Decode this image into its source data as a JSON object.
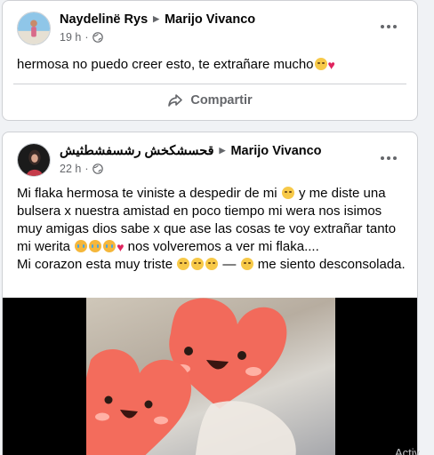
{
  "post1": {
    "author": "Naydelinë Rys",
    "target": "Marijo Vivanco",
    "time": "19 h",
    "text": "hermosa no puedo creer esto, te extrañare mucho",
    "share_label": "Compartir"
  },
  "post2": {
    "author": "قحسشکخش رشسفشطثيش",
    "target": "Marijo Vivanco",
    "time": "22 h",
    "lines": {
      "l1a": "Mi flaka hermosa te viniste a despedir de mi",
      "l1b": " y me diste una bulsera x nuestra amistad en poco tiempo mi wera nos isimos muy amigas dios sabe x que ase las cosas te voy extrañar tanto mi werita",
      "l1c": " nos volveremos a ver mi flaka....",
      "l2a": "Mi corazon esta muy triste",
      "l2b": " — ",
      "l2c": " me siento desconsolada."
    }
  },
  "watermark": "Activ",
  "icons": [
    "globe-icon",
    "more-icon",
    "share-icon",
    "arrow-icon",
    "pensive-emoji",
    "crying-emoji",
    "broken-heart-emoji",
    "heart-face-sticker"
  ],
  "colors": {
    "background": "#f0f2f5",
    "card": "#ffffff",
    "secondary_text": "#65676b",
    "heart": "#e0245e"
  }
}
